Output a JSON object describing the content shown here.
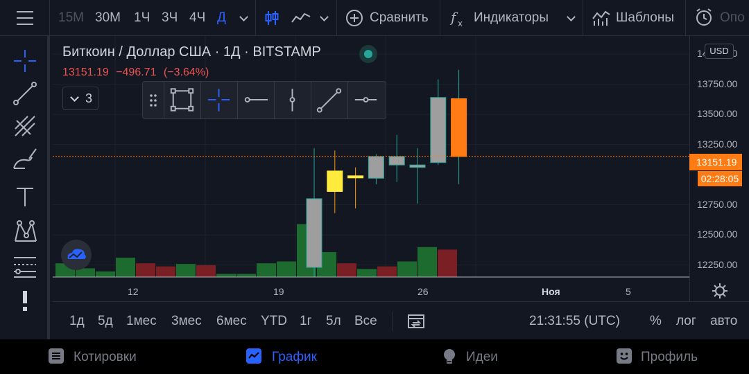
{
  "toolbar": {
    "intervals": [
      "15М",
      "30М",
      "1Ч",
      "3Ч",
      "4Ч",
      "Д"
    ],
    "active_interval": "Д",
    "compare_label": "Сравнить",
    "indicators_label": "Индикаторы",
    "templates_label": "Шаблоны",
    "alerts_label": "Опо"
  },
  "legend": {
    "title": "Биткоин / Доллар США · 1Д · BITSTAMP",
    "price": "13151.19",
    "change": "−496.71",
    "change_pct": "(−3.64%)",
    "collapse_count": "3"
  },
  "price_axis": {
    "currency": "USD",
    "ticks": [
      "14000.00",
      "13750.00",
      "13500.00",
      "13250.00",
      "12750.00",
      "12500.00",
      "12250.00"
    ],
    "last_price": "13151.19",
    "countdown": "02:28:05"
  },
  "time_axis": {
    "ticks": [
      "12",
      "19",
      "26",
      "Ноя",
      "5"
    ]
  },
  "ranges": {
    "items": [
      "1д",
      "5д",
      "1мес",
      "3мес",
      "6мес",
      "YTD",
      "1г",
      "5л",
      "Все"
    ],
    "clock": "21:31:55 (UTC)",
    "percent": "%",
    "log": "лог",
    "auto": "авто"
  },
  "nav": {
    "quotes": "Котировки",
    "chart": "График",
    "ideas": "Идеи",
    "profile": "Профиль"
  },
  "colors": {
    "accent": "#2962ff",
    "down": "#ef5350",
    "last_price": "#ff7c14"
  },
  "chart_data": {
    "type": "candlestick",
    "y_range": [
      12150,
      14150
    ],
    "last_price_line": 13151.19,
    "candles": [
      {
        "o": 12230,
        "h": 13220,
        "l": 12150,
        "c": 12800,
        "fill": "#9e9e9e"
      },
      {
        "o": 12860,
        "h": 13200,
        "l": 12680,
        "c": 13030,
        "fill": "#ffeb3b"
      },
      {
        "o": 12980,
        "h": 13060,
        "l": 12720,
        "c": 12990,
        "fill": "#ffeb3b"
      },
      {
        "o": 12970,
        "h": 13170,
        "l": 12920,
        "c": 13150,
        "fill": "#9e9e9e"
      },
      {
        "o": 13150,
        "h": 13330,
        "l": 12940,
        "c": 13080,
        "fill": "#9e9e9e"
      },
      {
        "o": 13080,
        "h": 13220,
        "l": 12760,
        "c": 13060,
        "fill": "#9e9e9e"
      },
      {
        "o": 13100,
        "h": 13790,
        "l": 13080,
        "c": 13640,
        "fill": "#9e9e9e"
      },
      {
        "o": 13630,
        "h": 13870,
        "l": 12920,
        "c": 13150,
        "fill": "#ff7c14"
      }
    ],
    "volumes": [
      {
        "v": 0.22,
        "color": "#1e6b2f"
      },
      {
        "v": 0.14,
        "color": "#1e6b2f"
      },
      {
        "v": 0.09,
        "color": "#1e6b2f"
      },
      {
        "v": 0.31,
        "color": "#1e6b2f"
      },
      {
        "v": 0.22,
        "color": "#7a1f24"
      },
      {
        "v": 0.17,
        "color": "#7a1f24"
      },
      {
        "v": 0.21,
        "color": "#1e6b2f"
      },
      {
        "v": 0.19,
        "color": "#7a1f24"
      },
      {
        "v": 0.05,
        "color": "#1e6b2f"
      },
      {
        "v": 0.05,
        "color": "#1e6b2f"
      },
      {
        "v": 0.22,
        "color": "#1e6b2f"
      },
      {
        "v": 0.25,
        "color": "#1e6b2f"
      },
      {
        "v": 0.85,
        "color": "#1e6b2f"
      },
      {
        "v": 0.4,
        "color": "#1e6b2f"
      },
      {
        "v": 0.22,
        "color": "#7a1f24"
      },
      {
        "v": 0.13,
        "color": "#1e6b2f"
      },
      {
        "v": 0.17,
        "color": "#7a1f24"
      },
      {
        "v": 0.25,
        "color": "#1e6b2f"
      },
      {
        "v": 0.48,
        "color": "#1e6b2f"
      },
      {
        "v": 0.44,
        "color": "#7a1f24"
      }
    ]
  }
}
